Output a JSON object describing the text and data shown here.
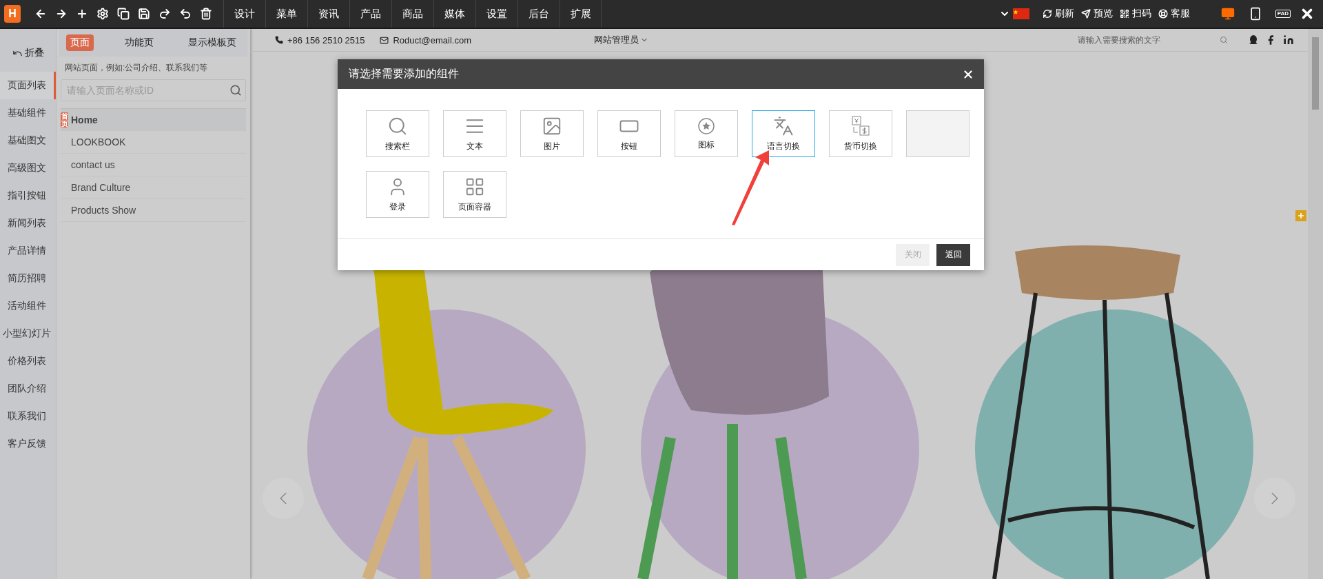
{
  "toolbar": {
    "logo": "H",
    "menu": [
      {
        "label": "设计"
      },
      {
        "label": "菜单"
      },
      {
        "label": "资讯"
      },
      {
        "label": "产品"
      },
      {
        "label": "商品"
      },
      {
        "label": "媒体"
      },
      {
        "label": "设置"
      },
      {
        "label": "后台"
      },
      {
        "label": "扩展"
      }
    ],
    "actions": [
      {
        "kind": "refresh",
        "label": "刷新"
      },
      {
        "kind": "preview",
        "label": "预览"
      },
      {
        "kind": "scan",
        "label": "扫码"
      },
      {
        "kind": "support",
        "label": "客服"
      }
    ],
    "devices": [
      {
        "kind": "desktop",
        "selected": true
      },
      {
        "kind": "phone",
        "selected": false
      },
      {
        "kind": "pad",
        "label": "PAD",
        "selected": false
      }
    ]
  },
  "rail": {
    "fold": "折叠",
    "items": [
      {
        "label": "页面列表",
        "selected": true
      },
      {
        "label": "基础组件",
        "selected": false
      },
      {
        "label": "基础图文",
        "selected": false
      },
      {
        "label": "高级图文",
        "selected": false
      },
      {
        "label": "指引按钮",
        "selected": false
      },
      {
        "label": "新闻列表",
        "selected": false
      },
      {
        "label": "产品详情",
        "selected": false
      },
      {
        "label": "简历招聘",
        "selected": false
      },
      {
        "label": "活动组件",
        "selected": false
      },
      {
        "label": "小型幻灯片",
        "selected": false
      },
      {
        "label": "价格列表",
        "selected": false
      },
      {
        "label": "团队介绍",
        "selected": false
      },
      {
        "label": "联系我们",
        "selected": false
      },
      {
        "label": "客户反馈",
        "selected": false
      }
    ]
  },
  "pages_panel": {
    "tabs": [
      {
        "label": "页面",
        "selected": true
      },
      {
        "label": "功能页",
        "selected": false
      },
      {
        "label": "显示模板页",
        "selected": false
      }
    ],
    "hint": "网站页面，例如:公司介绍、联系我们等",
    "search": {
      "placeholder": "请输入页面名称或ID"
    },
    "pages": [
      {
        "label": "Home",
        "badge": "首页",
        "selected": true
      },
      {
        "label": "LOOKBOOK",
        "selected": false
      },
      {
        "label": "contact us",
        "selected": false
      },
      {
        "label": "Brand Culture",
        "selected": false
      },
      {
        "label": "Products Show",
        "selected": false
      }
    ]
  },
  "site_header": {
    "phone": "+86 156 2510 2515",
    "email": "Roduct@email.com",
    "admin": "网站管理员",
    "search": {
      "placeholder": "请输入需要搜索的文字"
    }
  },
  "dialog": {
    "title": "请选择需要添加的组件",
    "components": [
      {
        "kind": "search",
        "label": "搜索栏",
        "selected": false
      },
      {
        "kind": "text",
        "label": "文本",
        "selected": false
      },
      {
        "kind": "image",
        "label": "图片",
        "selected": false
      },
      {
        "kind": "button",
        "label": "按钮",
        "selected": false
      },
      {
        "kind": "icon",
        "label": "图标",
        "selected": false
      },
      {
        "kind": "language",
        "label": "语言切换",
        "selected": true
      },
      {
        "kind": "currency",
        "label": "货币切换",
        "selected": false
      },
      {
        "kind": "empty",
        "selected": false
      },
      {
        "kind": "login",
        "label": "登录",
        "selected": false
      },
      {
        "kind": "container",
        "label": "页面容器",
        "selected": false
      }
    ],
    "buttons": [
      {
        "label": "关闭",
        "disabled": true
      },
      {
        "label": "返回",
        "disabled": false
      }
    ]
  }
}
